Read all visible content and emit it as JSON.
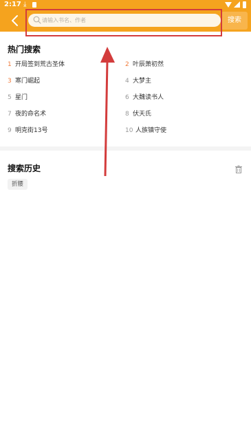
{
  "status_bar": {
    "time": "2:17"
  },
  "header": {
    "search_placeholder": "请输入书名、作者",
    "search_button_label": "搜索"
  },
  "hot_search": {
    "title": "热门搜索",
    "items": [
      {
        "rank": "1",
        "title": "开局签到荒古圣体",
        "highlight": true
      },
      {
        "rank": "2",
        "title": "叶辰萧初然",
        "highlight": true
      },
      {
        "rank": "3",
        "title": "寒门崛起",
        "highlight": true
      },
      {
        "rank": "4",
        "title": "大梦主",
        "highlight": false
      },
      {
        "rank": "5",
        "title": "星门",
        "highlight": false
      },
      {
        "rank": "6",
        "title": "大魏读书人",
        "highlight": false
      },
      {
        "rank": "7",
        "title": "夜的命名术",
        "highlight": false
      },
      {
        "rank": "8",
        "title": "伏天氏",
        "highlight": false
      },
      {
        "rank": "9",
        "title": "明克街13号",
        "highlight": false
      },
      {
        "rank": "10",
        "title": "人族镇守使",
        "highlight": false
      }
    ]
  },
  "search_history": {
    "title": "搜索历史",
    "items": [
      {
        "label": "折腰"
      }
    ]
  },
  "annotations": {
    "box_color": "#d33c3c",
    "arrow_color": "#d33c3c"
  },
  "colors": {
    "accent": "#f5a31e",
    "rank_highlight": "#f07a3a"
  }
}
